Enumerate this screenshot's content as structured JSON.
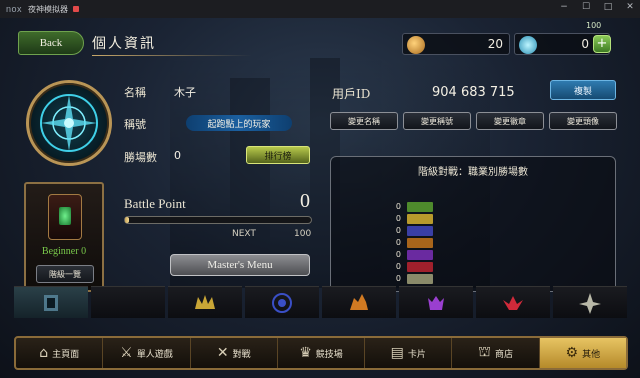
{
  "emulator": {
    "brand": "nox",
    "title": "夜神模拟器",
    "controls": [
      "−",
      "☐",
      "□",
      "✕"
    ]
  },
  "header": {
    "back_label": "Back",
    "page_title": "個人資訊",
    "gold": "20",
    "gems": "0",
    "add_label": "+",
    "battery": "100"
  },
  "profile": {
    "name_label": "名稱",
    "name_value": "木子",
    "title_label": "稱號",
    "title_value": "起跑點上的玩家",
    "wins_label": "勝場數",
    "wins_value": "0",
    "ranking_button": "排行榜",
    "user_id_label": "用戶ID",
    "user_id_value": "904 683 715",
    "copy_button": "複製",
    "actions": [
      "變更名稱",
      "變更稱號",
      "變更徽章",
      "變更頭像"
    ]
  },
  "character": {
    "rank_label": "Beginner 0",
    "level_list_button": "階級一覽"
  },
  "battle_point": {
    "label": "Battle Point",
    "value": "0",
    "progress": 0.02,
    "next_label": "NEXT",
    "next_value": "100",
    "masters_menu": "Master's Menu"
  },
  "ladder": {
    "title": "階級對戰：職業別勝場數",
    "rows": [
      {
        "count": "0",
        "color": "#4e8a2c"
      },
      {
        "count": "0",
        "color": "#b89a2c"
      },
      {
        "count": "0",
        "color": "#3a3fa6"
      },
      {
        "count": "0",
        "color": "#a8651b"
      },
      {
        "count": "0",
        "color": "#6a2aa0"
      },
      {
        "count": "0",
        "color": "#a0202c"
      },
      {
        "count": "0",
        "color": "#8a8a6a"
      }
    ]
  },
  "class_tabs": [
    {
      "name": "neutral",
      "color": "#5a8aa0"
    },
    {
      "name": "forest",
      "color": "#4e8a2c"
    },
    {
      "name": "sword",
      "color": "#c9a636"
    },
    {
      "name": "rune",
      "color": "#3a4fc6"
    },
    {
      "name": "dragon",
      "color": "#d17a22"
    },
    {
      "name": "shadow",
      "color": "#9a3fd0"
    },
    {
      "name": "blood",
      "color": "#d02a3a"
    },
    {
      "name": "haven",
      "color": "#b8b8a8"
    }
  ],
  "nav": [
    {
      "label": "主頁面",
      "icon": "⌂",
      "active": false
    },
    {
      "label": "單人遊戲",
      "icon": "⚔",
      "active": false
    },
    {
      "label": "對戰",
      "icon": "✕",
      "active": false
    },
    {
      "label": "競技場",
      "icon": "♛",
      "active": false
    },
    {
      "label": "卡片",
      "icon": "▤",
      "active": false
    },
    {
      "label": "商店",
      "icon": "⛫",
      "active": false
    },
    {
      "label": "其他",
      "icon": "⚙",
      "active": true
    }
  ]
}
